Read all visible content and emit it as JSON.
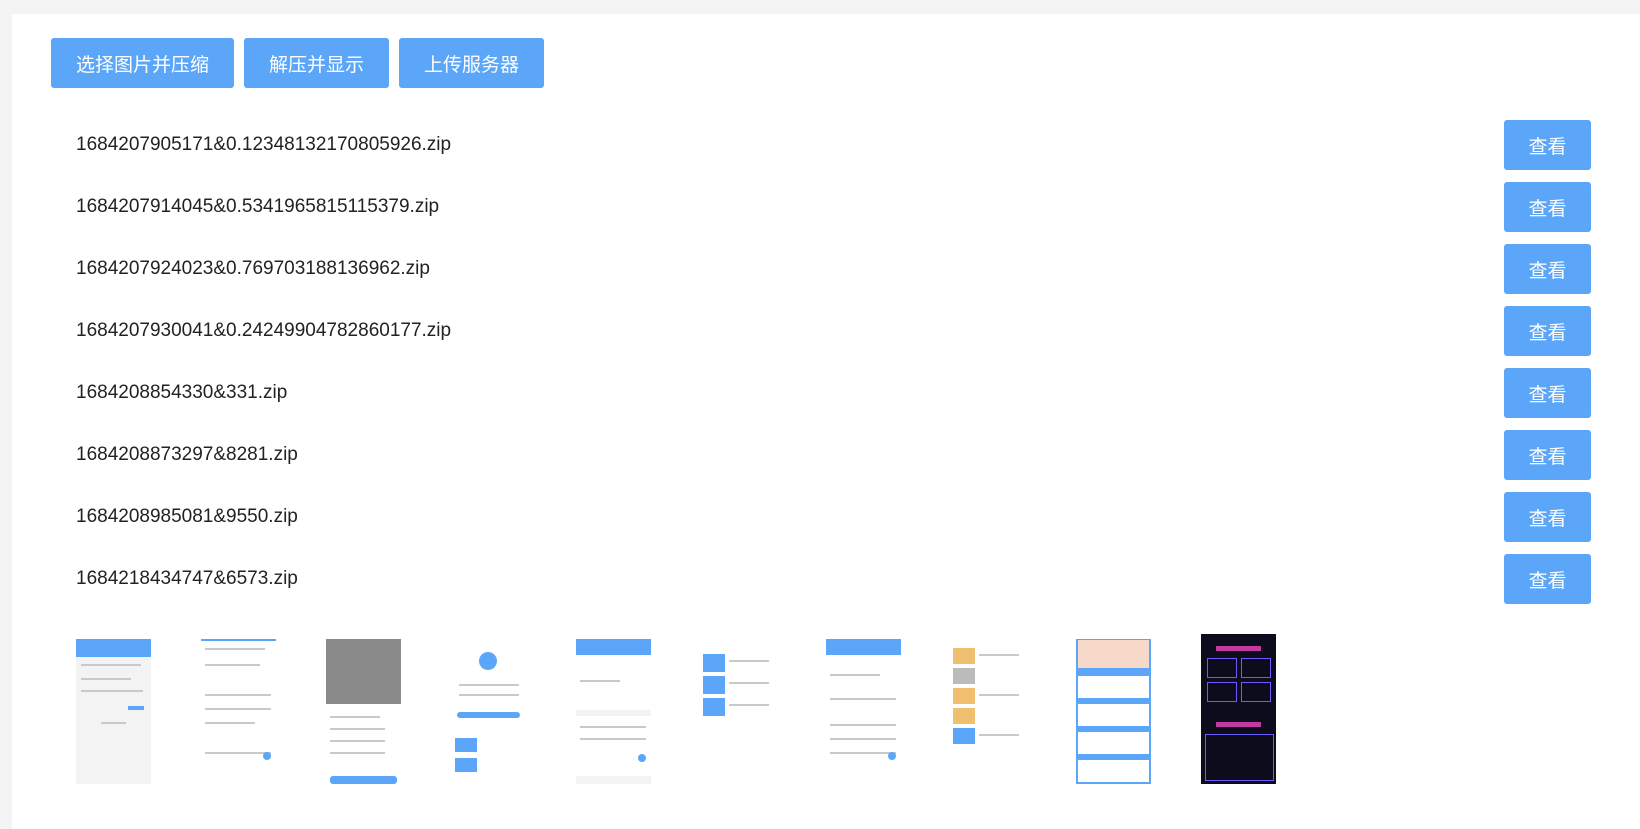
{
  "toolbar": {
    "select_compress": "选择图片并压缩",
    "decompress_show": "解压并显示",
    "upload_server": "上传服务器"
  },
  "view_label": "查看",
  "files": [
    "1684207905171&0.12348132170805926.zip",
    "1684207914045&0.5341965815115379.zip",
    "1684207924023&0.769703188136962.zip",
    "1684207930041&0.24249904782860177.zip",
    "1684208854330&331.zip",
    "1684208873297&8281.zip",
    "1684208985081&9550.zip",
    "1684218434747&6573.zip"
  ],
  "thumbnails": [
    "list",
    "form",
    "sheet",
    "success",
    "order",
    "coupon",
    "detail",
    "coupon-color",
    "promo",
    "dark-event"
  ],
  "colors": {
    "accent": "#5ba6f8"
  }
}
